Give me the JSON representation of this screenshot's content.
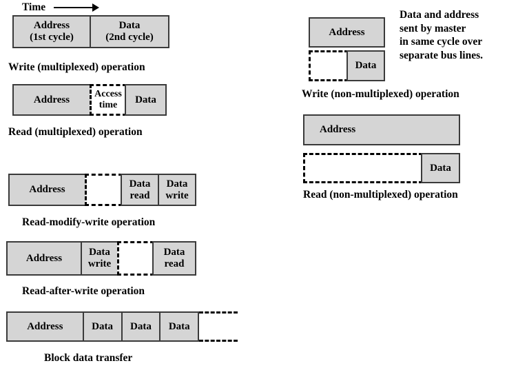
{
  "figure": {
    "time_axis": {
      "label": "Time",
      "arrow_icon": "right-arrow-icon"
    },
    "side_note": {
      "lines": [
        "Data and address",
        "sent by master",
        "in same cycle over",
        "separate bus lines."
      ]
    },
    "colors": {
      "cell_fill": "#d5d5d5",
      "cell_border": "#3a3a3a",
      "dashed_border": "#000000",
      "background": "#ffffff",
      "text": "#000000"
    },
    "diagrams": [
      {
        "id": "write-multiplexed",
        "caption": "Write (multiplexed) operation",
        "cells": [
          {
            "kind": "solid",
            "line1": "Address",
            "line2": "(1st cycle)"
          },
          {
            "kind": "solid",
            "line1": "Data",
            "line2": "(2nd cycle)"
          }
        ]
      },
      {
        "id": "read-multiplexed",
        "caption": "Read (multiplexed) operation",
        "cells": [
          {
            "kind": "solid",
            "line1": "Address",
            "line2": ""
          },
          {
            "kind": "dashed",
            "line1": "Access",
            "line2": "time"
          },
          {
            "kind": "solid",
            "line1": "Data",
            "line2": ""
          }
        ]
      },
      {
        "id": "read-modify-write",
        "caption": "Read-modify-write operation",
        "cells": [
          {
            "kind": "solid",
            "line1": "Address",
            "line2": ""
          },
          {
            "kind": "dashed",
            "line1": "",
            "line2": ""
          },
          {
            "kind": "solid",
            "line1": "Data",
            "line2": "read"
          },
          {
            "kind": "solid",
            "line1": "Data",
            "line2": "write"
          }
        ]
      },
      {
        "id": "read-after-write",
        "caption": "Read-after-write operation",
        "cells": [
          {
            "kind": "solid",
            "line1": "Address",
            "line2": ""
          },
          {
            "kind": "solid",
            "line1": "Data",
            "line2": "write"
          },
          {
            "kind": "dashed",
            "line1": "",
            "line2": ""
          },
          {
            "kind": "solid",
            "line1": "Data",
            "line2": "read"
          }
        ]
      },
      {
        "id": "block-data-transfer",
        "caption": "Block data transfer",
        "cells": [
          {
            "kind": "solid",
            "line1": "Address",
            "line2": ""
          },
          {
            "kind": "solid",
            "line1": "Data",
            "line2": ""
          },
          {
            "kind": "solid",
            "line1": "Data",
            "line2": ""
          },
          {
            "kind": "solid",
            "line1": "Data",
            "line2": ""
          },
          {
            "kind": "open-dashed",
            "line1": "",
            "line2": ""
          }
        ]
      },
      {
        "id": "write-non-multiplexed",
        "caption": "Write (non-multiplexed) operation",
        "address_row": [
          {
            "kind": "solid",
            "line1": "Address",
            "line2": ""
          }
        ],
        "data_row": [
          {
            "kind": "dashed",
            "line1": "",
            "line2": ""
          },
          {
            "kind": "solid",
            "line1": "Data",
            "line2": ""
          }
        ]
      },
      {
        "id": "read-non-multiplexed",
        "caption": "Read (non-multiplexed) operation",
        "address_row": [
          {
            "kind": "solid",
            "line1": "Address",
            "line2": ""
          }
        ],
        "data_row": [
          {
            "kind": "dashed",
            "line1": "",
            "line2": ""
          },
          {
            "kind": "solid",
            "line1": "Data",
            "line2": ""
          }
        ]
      }
    ]
  }
}
